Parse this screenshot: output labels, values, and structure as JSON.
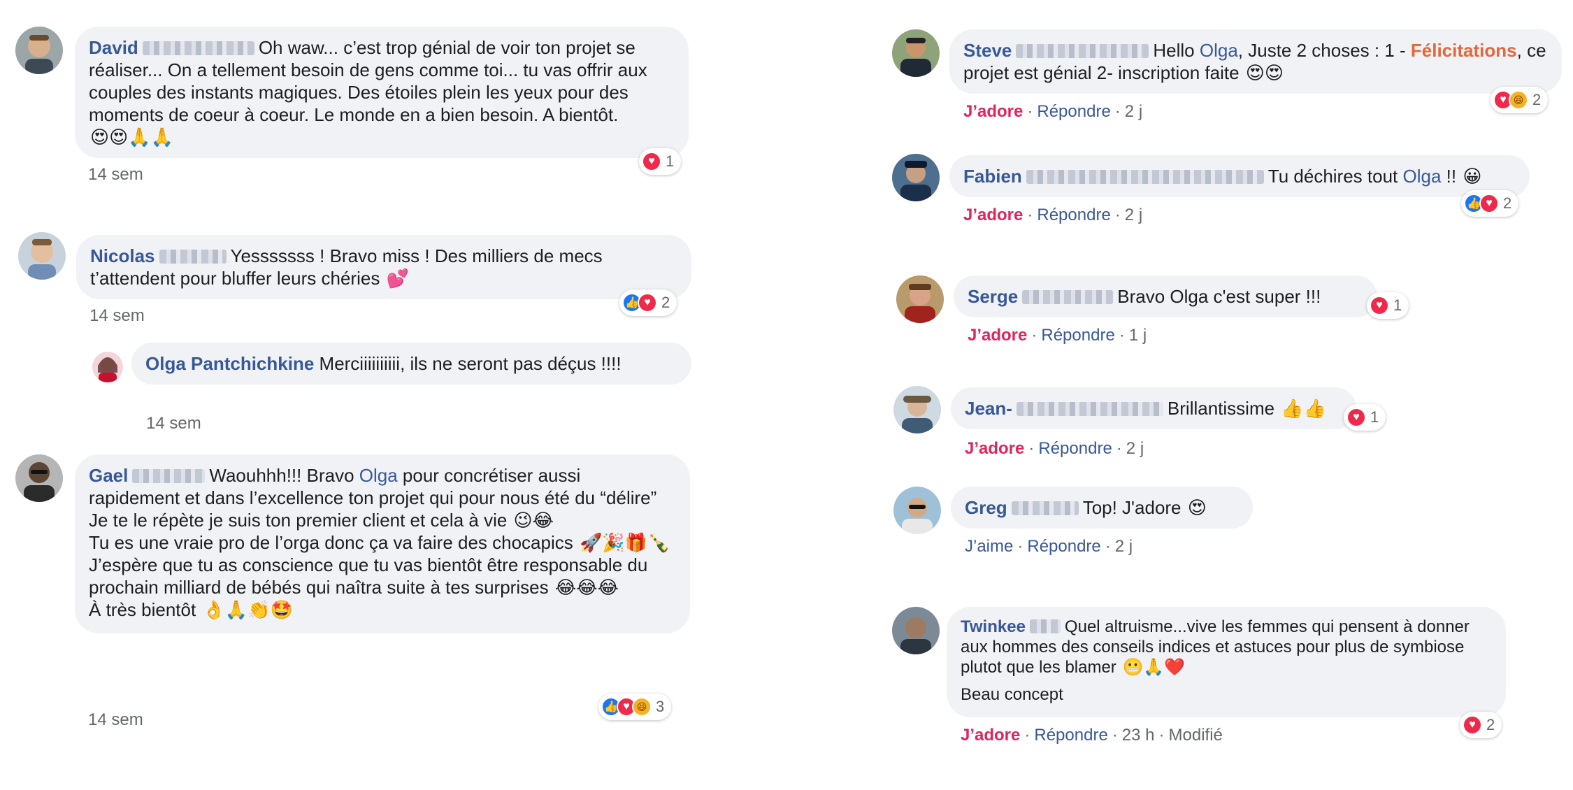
{
  "left": [
    {
      "name": "David",
      "text": "Oh waw... c’est trop génial de voir ton projet se réaliser... On a tellement besoin de gens comme toi... tu vas offrir aux couples des instants magiques. Des étoiles plein les yeux pour des moments de coeur à coeur. Le monde en a bien besoin. A bientôt.",
      "emojis": "😍😍🙏🙏",
      "reaction_count": "1",
      "time": "14 sem"
    },
    {
      "name": "Nicolas",
      "text": "Yesssssss ! Bravo miss ! Des milliers de mecs t’attendent pour bluffer leurs chéries",
      "emojis": "💕",
      "reaction_count": "2",
      "time": "14 sem"
    },
    {
      "name": "Olga Pantchichkine",
      "text": "Merciiiiiiiiii, ils ne seront pas déçus !!!!",
      "time": "14 sem"
    },
    {
      "name": "Gael",
      "text_a": "Waouhhh!!! Bravo",
      "mention": "Olga",
      "text_b": "pour concrétiser aussi rapidement et dans l’excellence ton projet qui pour nous été du “délire”",
      "line2": "Je te le répète je suis ton premier client et cela à vie",
      "line2_emojis": "😉😂",
      "line3": "Tu es une vraie pro de l’orga donc ça va faire des chocapics",
      "line3_emojis": "🚀🎉🎁🍾",
      "line4": "J’espère que tu as conscience que tu vas bientôt être responsable du prochain milliard de bébés qui naîtra suite à tes surprises",
      "line4_emojis": "😂😂😂",
      "line5": "À très bientôt",
      "line5_emojis": "👌🙏👏🤩",
      "reaction_count": "3",
      "time": "14 sem"
    }
  ],
  "right": [
    {
      "name": "Steve",
      "text_a": "Hello",
      "mention": "Olga",
      "text_b": ", Juste 2 choses : 1 -",
      "highlight": "Félicitations",
      "text_c": ", ce projet est génial 2- inscription faite",
      "emojis": "😍😍",
      "reaction_count": "2",
      "action": "J’adore",
      "reply": "Répondre",
      "time": "2 j"
    },
    {
      "name": "Fabien",
      "text_a": "Tu déchires tout",
      "mention": "Olga",
      "text_b": "!!",
      "emojis": "😀",
      "reaction_count": "2",
      "action": "J’adore",
      "reply": "Répondre",
      "time": "2 j"
    },
    {
      "name": "Serge",
      "text": "Bravo Olga c'est super !!!",
      "reaction_count": "1",
      "action": "J’adore",
      "reply": "Répondre",
      "time": "1 j"
    },
    {
      "name": "Jean-",
      "text": "Brillantissime",
      "emojis": "👍👍",
      "reaction_count": "1",
      "action": "J’adore",
      "reply": "Répondre",
      "time": "2 j"
    },
    {
      "name": "Greg",
      "text": "Top! J'adore",
      "emojis": "😍",
      "action": "J’aime",
      "reply": "Répondre",
      "time": "2 j"
    },
    {
      "name": "Twinkee",
      "text": "Quel altruisme...vive les femmes qui pensent à donner aux hommes des conseils indices et astuces pour plus de symbiose plutot que les blamer",
      "emojis": "😬🙏❤️",
      "text2": "Beau concept",
      "reaction_count": "2",
      "action": "J’adore",
      "reply": "Répondre",
      "time": "23 h",
      "edited": "Modifié"
    }
  ],
  "colors": {
    "name": "#385898",
    "love": "#e0245e",
    "bubble": "#f0f2f5",
    "meta": "#65676b"
  }
}
